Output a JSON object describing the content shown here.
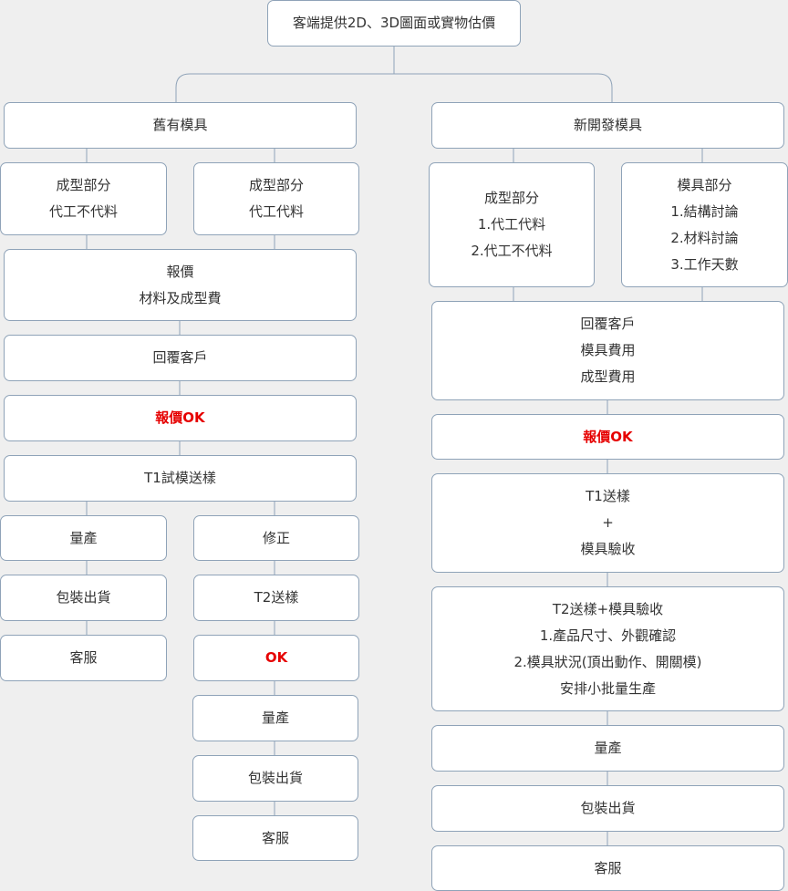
{
  "colors": {
    "background": "#efefef",
    "box_fill": "#ffffff",
    "border": "#8fa3b8",
    "text": "#333333",
    "highlight": "#e60000"
  },
  "root": {
    "label": "客端提供2D、3D圖面或實物估價"
  },
  "left": {
    "title": "舊有模具",
    "branch_a": {
      "heading": "成型部分",
      "line": "代工不代料"
    },
    "branch_b": {
      "heading": "成型部分",
      "line": "代工代料"
    },
    "quote": {
      "heading": "報價",
      "line": "材料及成型費"
    },
    "reply": "回覆客戶",
    "quote_ok": "報價OK",
    "t1": "T1試模送樣",
    "ok_path": [
      "量產",
      "包裝出貨",
      "客服"
    ],
    "fix_path": {
      "fix": "修正",
      "t2": "T2送樣",
      "ok": "OK",
      "after": [
        "量產",
        "包裝出貨",
        "客服"
      ]
    }
  },
  "right": {
    "title": "新開發模具",
    "molding": {
      "heading": "成型部分",
      "items": [
        "1.代工代料",
        "2.代工不代料"
      ]
    },
    "mold": {
      "heading": "模具部分",
      "items": [
        "1.結構討論",
        "2.材料討論",
        "3.工作天數"
      ]
    },
    "reply": {
      "heading": "回覆客戶",
      "items": [
        "模具費用",
        "成型費用"
      ]
    },
    "quote_ok": "報價OK",
    "t1": {
      "line1": "T1送樣",
      "plus": "+",
      "line2": "模具驗收"
    },
    "t2": {
      "heading": "T2送樣+模具驗收",
      "items": [
        "1.產品尺寸、外觀確認",
        "2.模具狀況(頂出動作、開關模)",
        "安排小批量生產"
      ]
    },
    "after": [
      "量產",
      "包裝出貨",
      "客服"
    ]
  }
}
